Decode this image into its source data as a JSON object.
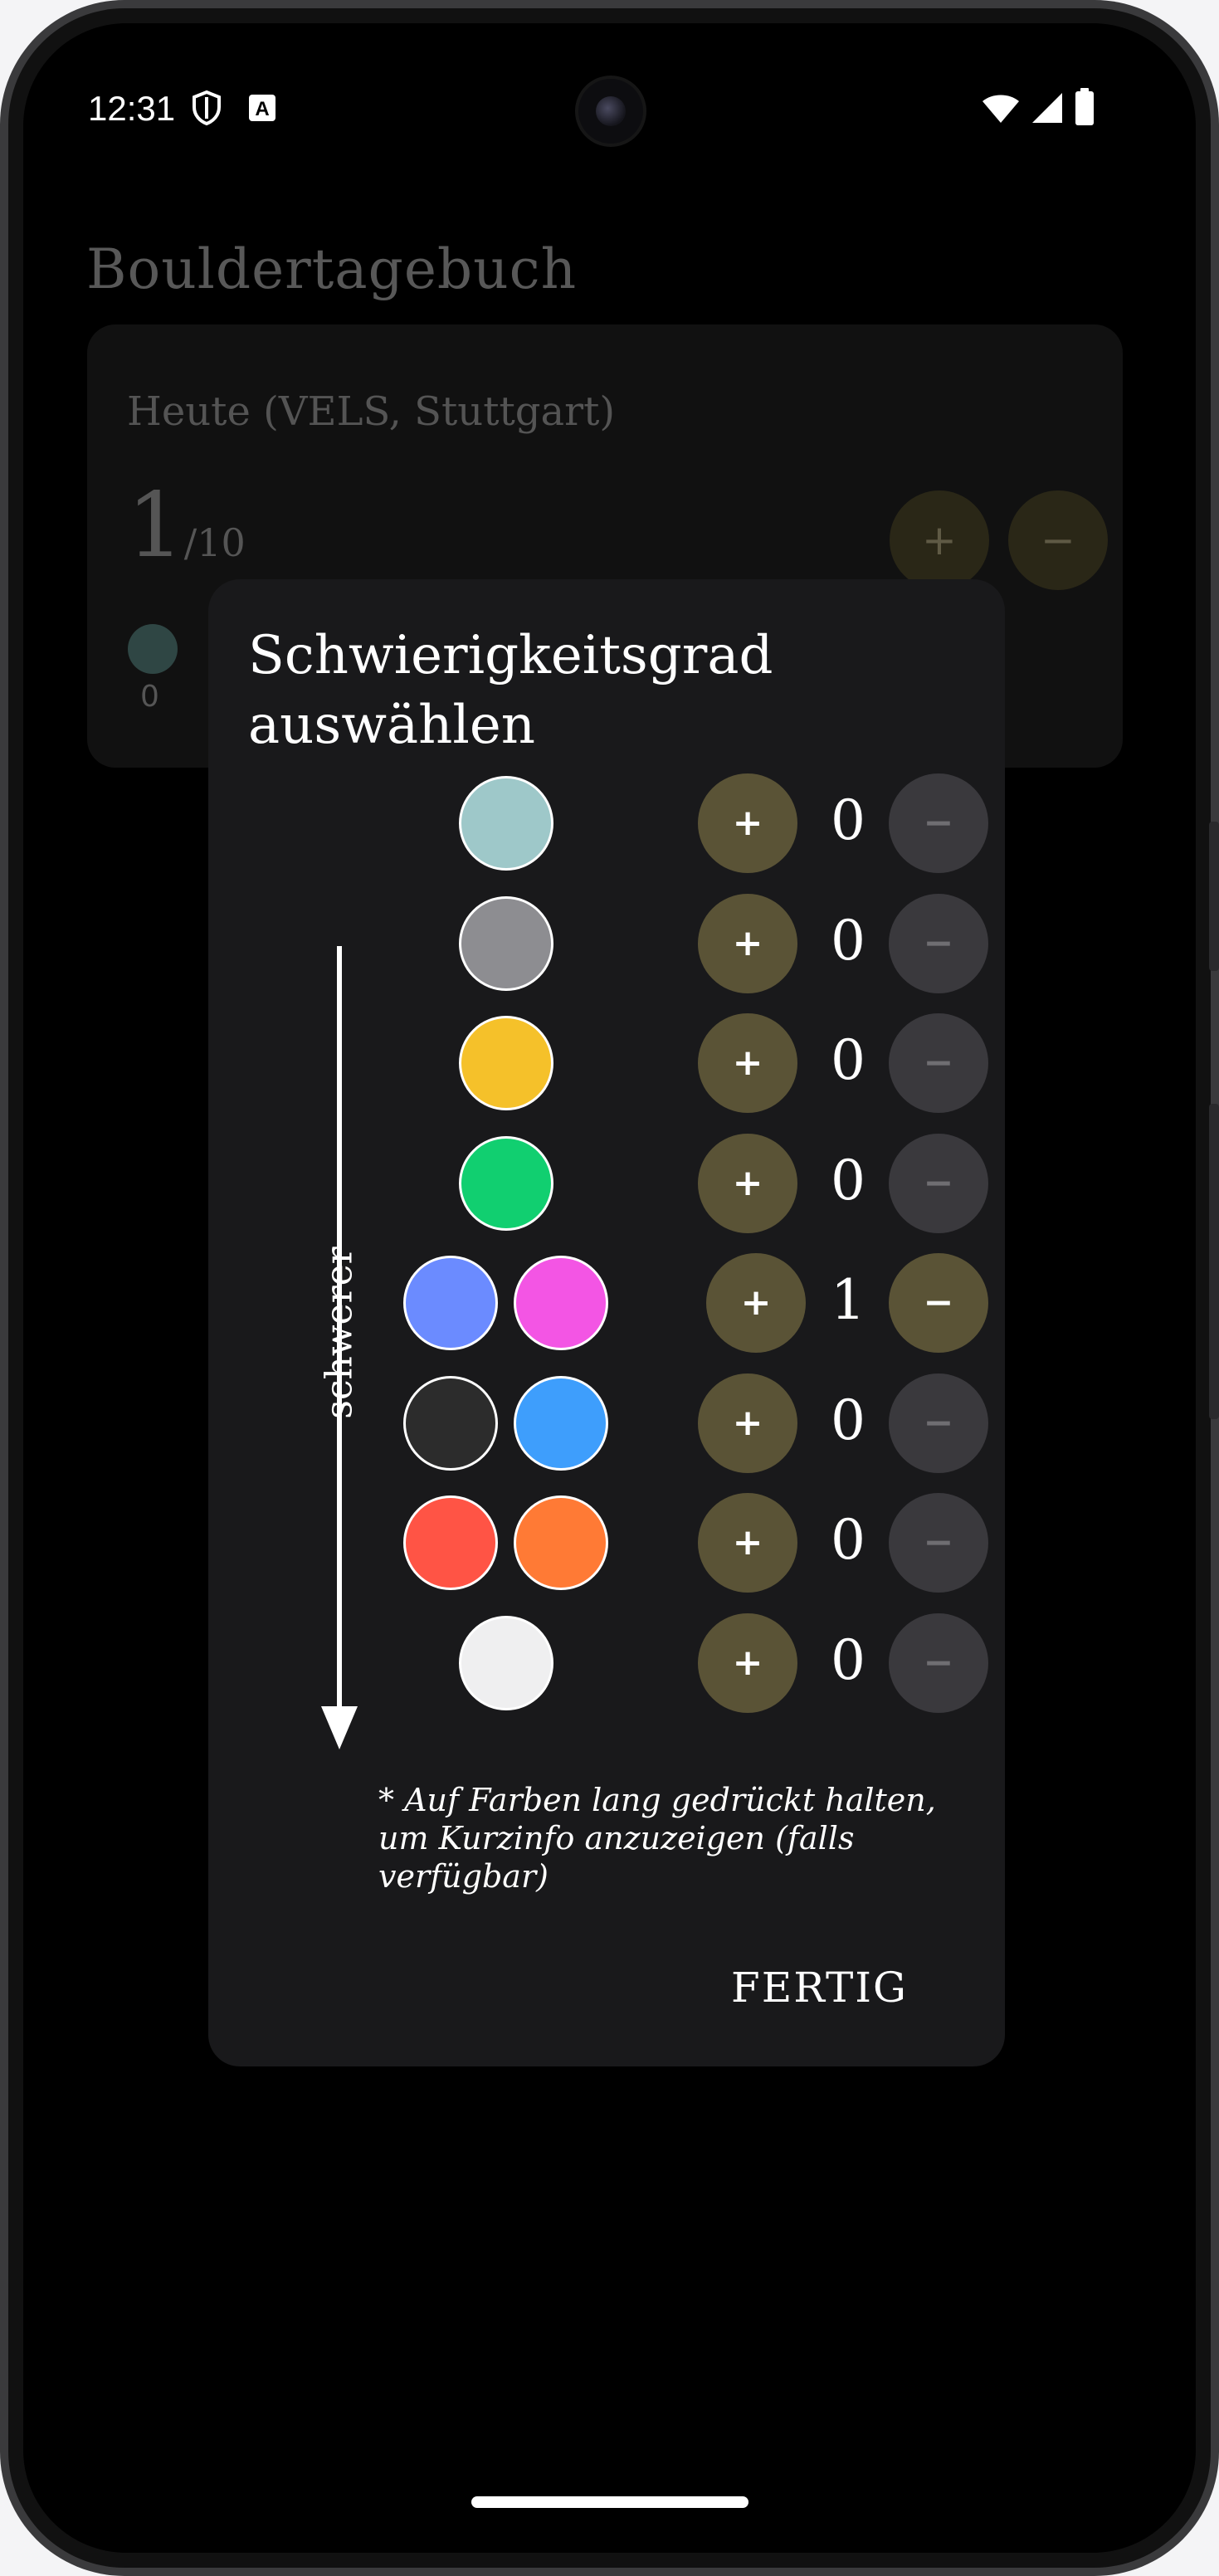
{
  "status_bar": {
    "time": "12:31",
    "icons": [
      "shield-icon",
      "font-a-icon",
      "wifi-icon",
      "signal-icon",
      "battery-icon"
    ],
    "a_icon_letter": "A"
  },
  "app": {
    "title": "Bouldertagebuch",
    "today_card": {
      "label": "Heute (VELS, Stuttgart)",
      "count": "1",
      "count_suffix": "/10",
      "plus_label": "+",
      "minus_label": "−",
      "swatch_color": "#2f4644",
      "swatch_count": "0"
    }
  },
  "dialog": {
    "title": "Schwierigkeitsgrad auswählen",
    "harder_label": "schwerer",
    "plus_label": "+",
    "minus_label": "−",
    "grades": [
      {
        "colors": [
          "#9ec8c9"
        ],
        "count": "0",
        "minus_active": false
      },
      {
        "colors": [
          "#8d8d91"
        ],
        "count": "0",
        "minus_active": false
      },
      {
        "colors": [
          "#f5c12a"
        ],
        "count": "0",
        "minus_active": false
      },
      {
        "colors": [
          "#11cf70"
        ],
        "count": "0",
        "minus_active": false
      },
      {
        "colors": [
          "#6b8bff",
          "#f355e4"
        ],
        "count": "1",
        "minus_active": true
      },
      {
        "colors": [
          "#2c2c2c",
          "#3e9efc"
        ],
        "count": "0",
        "minus_active": false
      },
      {
        "colors": [
          "#ff5445",
          "#ff7a35"
        ],
        "count": "0",
        "minus_active": false
      },
      {
        "colors": [
          "#efeff0"
        ],
        "count": "0",
        "minus_active": false
      }
    ],
    "hint": "* Auf Farben lang gedrückt halten, um Kurzinfo anzuzeigen (falls verfügbar)",
    "done_label": "FERTIG"
  },
  "colors": {
    "dialog_bg": "#19191b",
    "accent_button": "#5a5336",
    "disabled_button": "#3a393d"
  }
}
